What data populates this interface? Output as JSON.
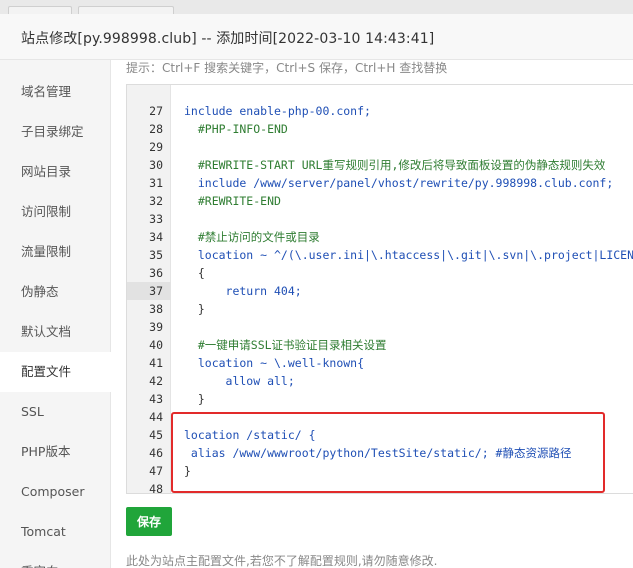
{
  "dialog": {
    "title": "站点修改[py.998998.club] -- 添加时间[2022-03-10 14:43:41]"
  },
  "sidebar": {
    "items": [
      {
        "label": "域名管理"
      },
      {
        "label": "子目录绑定"
      },
      {
        "label": "网站目录"
      },
      {
        "label": "访问限制"
      },
      {
        "label": "流量限制"
      },
      {
        "label": "伪静态"
      },
      {
        "label": "默认文档"
      },
      {
        "label": "配置文件"
      },
      {
        "label": "SSL"
      },
      {
        "label": "PHP版本"
      },
      {
        "label": "Composer"
      },
      {
        "label": "Tomcat"
      },
      {
        "label": "重定向"
      }
    ],
    "active": "配置文件"
  },
  "editor": {
    "hint": "提示：Ctrl+F 搜索关键字，Ctrl+S 保存，Ctrl+H 查找替换",
    "active_line": "38",
    "lines": [
      {
        "num": "27",
        "text": "include enable-php-00.conf;"
      },
      {
        "num": "28",
        "text": "  #PHP-INFO-END"
      },
      {
        "num": "29",
        "text": ""
      },
      {
        "num": "30",
        "text": "  #REWRITE-START URL重写规则引用,修改后将导致面板设置的伪静态规则失效"
      },
      {
        "num": "31",
        "text": "  include /www/server/panel/vhost/rewrite/py.998998.club.conf;"
      },
      {
        "num": "32",
        "text": "  #REWRITE-END"
      },
      {
        "num": "33",
        "text": ""
      },
      {
        "num": "34",
        "text": "  #禁止访问的文件或目录"
      },
      {
        "num": "35",
        "text": "  location ~ ^/(\\.user.ini|\\.htaccess|\\.git|\\.svn|\\.project|LICENSE|README.md)"
      },
      {
        "num": "36",
        "text": "  {"
      },
      {
        "num": "37",
        "text": "      return 404;"
      },
      {
        "num": "38",
        "text": "  }"
      },
      {
        "num": "39",
        "text": ""
      },
      {
        "num": "40",
        "text": "  #一键申请SSL证书验证目录相关设置"
      },
      {
        "num": "41",
        "text": "  location ~ \\.well-known{"
      },
      {
        "num": "42",
        "text": "      allow all;"
      },
      {
        "num": "43",
        "text": "  }"
      },
      {
        "num": "44",
        "text": ""
      },
      {
        "num": "45",
        "text": "location /static/ {"
      },
      {
        "num": "46",
        "text": " alias /www/wwwroot/python/TestSite/static/; #静态资源路径"
      },
      {
        "num": "47",
        "text": "}"
      },
      {
        "num": "48",
        "text": ""
      }
    ]
  },
  "actions": {
    "save_label": "保存"
  },
  "footer": {
    "note": "此处为站点主配置文件,若您不了解配置规则,请勿随意修改."
  },
  "colors": {
    "accent_green": "#20a53a",
    "highlight_red": "#e22a2a",
    "comment_green": "#2f7d32",
    "keyword_blue": "#1f4fb5"
  }
}
